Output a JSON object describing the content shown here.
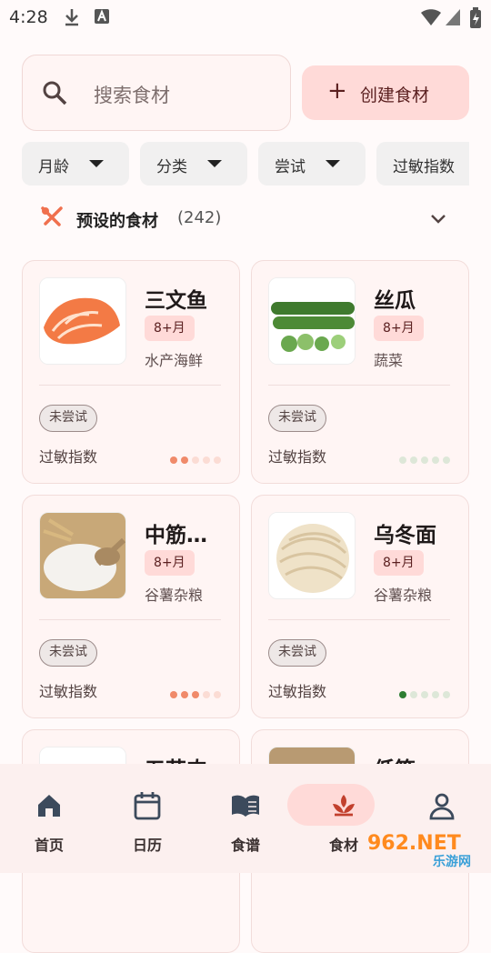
{
  "status_bar": {
    "time": "4:28"
  },
  "search": {
    "placeholder": "搜索食材"
  },
  "create_button": {
    "icon": "plus-icon",
    "label": "创建食材"
  },
  "filters": [
    {
      "label": "月龄",
      "icon": "caret-down-icon"
    },
    {
      "label": "分类",
      "icon": "caret-down-icon"
    },
    {
      "label": "尝试",
      "icon": "caret-down-icon"
    },
    {
      "label": "过敏指数",
      "icon": "caret-down-icon"
    }
  ],
  "section": {
    "icon": "fork-knife-icon",
    "title": "预设的食材",
    "count": "(242)"
  },
  "foods": [
    {
      "name": "三文鱼",
      "age": "8+月",
      "category": "水产海鲜",
      "tried": "未尝试",
      "allergy_label": "过敏指数",
      "allergy_level": 2,
      "allergy_color": "#f08a6a",
      "image": "salmon-image"
    },
    {
      "name": "丝瓜",
      "age": "8+月",
      "category": "蔬菜",
      "tried": "未尝试",
      "allergy_label": "过敏指数",
      "allergy_level": 0,
      "allergy_color": "#2e7d32",
      "image": "loofah-image"
    },
    {
      "name": "中筋…",
      "age": "8+月",
      "category": "谷薯杂粮",
      "tried": "未尝试",
      "allergy_label": "过敏指数",
      "allergy_level": 3,
      "allergy_color": "#f08a6a",
      "image": "flour-image"
    },
    {
      "name": "乌冬面",
      "age": "8+月",
      "category": "谷薯杂粮",
      "tried": "未尝试",
      "allergy_label": "过敏指数",
      "allergy_level": 1,
      "allergy_color": "#2e7d32",
      "image": "udon-image"
    },
    {
      "name": "五花肉",
      "image": "pork-belly-image"
    },
    {
      "name": "低筋",
      "image": "low-gluten-flour-image"
    }
  ],
  "bottom_nav": [
    {
      "label": "首页",
      "icon": "home-icon",
      "active": false
    },
    {
      "label": "日历",
      "icon": "calendar-icon",
      "active": false
    },
    {
      "label": "食谱",
      "icon": "book-icon",
      "active": false
    },
    {
      "label": "食材",
      "icon": "food-icon",
      "active": true
    },
    {
      "label": "",
      "icon": "person-icon",
      "active": false
    }
  ],
  "watermark": {
    "text": "962.NET",
    "subtext": "乐游网"
  },
  "colors": {
    "accent": "#ffdad8",
    "accent_dark": "#5a1f1f",
    "dot_inactive_warm": "#fbdcd4",
    "dot_inactive_green": "#dde7d8"
  }
}
